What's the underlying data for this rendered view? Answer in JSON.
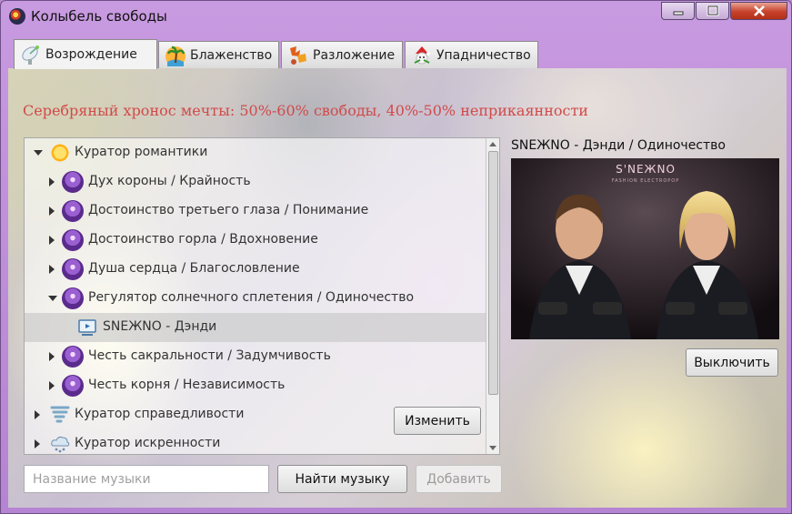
{
  "window": {
    "title": "Колыбель свободы"
  },
  "tabs": [
    {
      "label": "Возрождение",
      "icon": "satellite-dish-icon",
      "active": true
    },
    {
      "label": "Блаженство",
      "icon": "palm-tree-icon",
      "active": false
    },
    {
      "label": "Разложение",
      "icon": "autumn-leaves-icon",
      "active": false
    },
    {
      "label": "Упадничество",
      "icon": "santa-snowman-icon",
      "active": false
    }
  ],
  "headline": "Серебряный хронос мечты: 50%-60% свободы, 40%-50% неприкаянности",
  "tree": {
    "items": [
      {
        "label": "Куратор романтики",
        "level": 0,
        "expanded": true,
        "icon": "sun-icon"
      },
      {
        "label": "Дух короны / Крайность",
        "level": 1,
        "expanded": false,
        "icon": "chakra-icon"
      },
      {
        "label": "Достоинство третьего глаза / Понимание",
        "level": 1,
        "expanded": false,
        "icon": "chakra-icon"
      },
      {
        "label": "Достоинство горла / Вдохновение",
        "level": 1,
        "expanded": false,
        "icon": "chakra-icon"
      },
      {
        "label": "Душа сердца / Благословление",
        "level": 1,
        "expanded": false,
        "icon": "chakra-icon"
      },
      {
        "label": "Регулятор солнечного сплетения / Одиночество",
        "level": 1,
        "expanded": true,
        "icon": "chakra-icon"
      },
      {
        "label": "SNEЖNO - Дэнди",
        "level": 2,
        "selected": true,
        "icon": "tv-icon"
      },
      {
        "label": "Честь сакральности / Задумчивость",
        "level": 1,
        "expanded": false,
        "icon": "chakra-icon"
      },
      {
        "label": "Честь корня / Независимость",
        "level": 1,
        "expanded": false,
        "icon": "chakra-icon"
      },
      {
        "label": "Куратор справедливости",
        "level": 0,
        "expanded": false,
        "icon": "tornado-icon"
      },
      {
        "label": "Куратор искренности",
        "level": 0,
        "expanded": false,
        "icon": "snow-cloud-icon"
      }
    ]
  },
  "buttons": {
    "change": "Изменить",
    "find": "Найти музыку",
    "add": "Добавить",
    "off": "Выключить"
  },
  "search": {
    "placeholder": "Название музыки",
    "value": ""
  },
  "now_playing": {
    "title": "SNEЖNO - Дэнди / Одиночество",
    "cover_text_main": "S'NEЖNO",
    "cover_text_sub": "FASHION ELECTROPOP"
  },
  "colors": {
    "headline": "#d14a4a",
    "frame": "#c89ae0",
    "close": "#c7412b"
  }
}
